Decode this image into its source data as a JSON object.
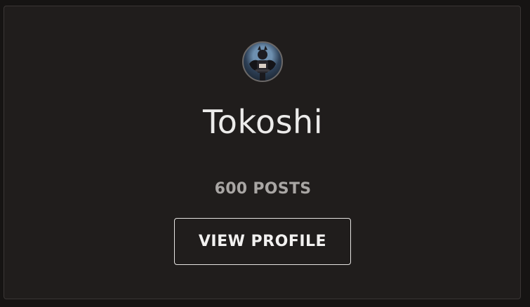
{
  "profile": {
    "name": "Tokoshi",
    "posts_label": "600 POSTS",
    "button_label": "VIEW PROFILE",
    "avatar_icon": "user-avatar-image"
  },
  "colors": {
    "card_background": "#201d1c",
    "page_background": "#161413",
    "name_text": "#ecebea",
    "posts_text": "#a9a6a4",
    "button_border": "#e6e4e2"
  }
}
